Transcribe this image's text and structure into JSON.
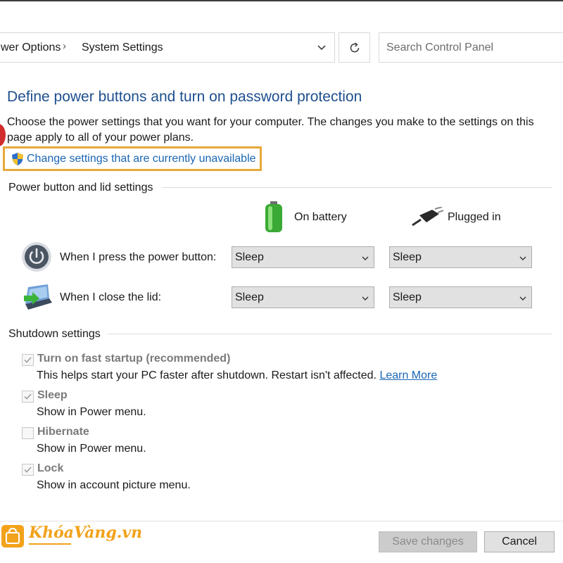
{
  "breadcrumb": {
    "item1": "wer Options",
    "separator": "›",
    "item2": "System Settings"
  },
  "search": {
    "placeholder": "Search Control Panel"
  },
  "page": {
    "title": "Define power buttons and turn on password protection",
    "description": "Choose the power settings that you want for your computer. The changes you make to the settings on this page apply to all of your power plans.",
    "change_link": "Change settings that are currently unavailable"
  },
  "power_section": {
    "label": "Power button and lid settings",
    "col_battery": "On battery",
    "col_plugged": "Plugged in",
    "rows": [
      {
        "label": "When I press the power button:",
        "battery": "Sleep",
        "plugged": "Sleep"
      },
      {
        "label": "When I close the lid:",
        "battery": "Sleep",
        "plugged": "Sleep"
      }
    ]
  },
  "shutdown_section": {
    "label": "Shutdown settings",
    "options": [
      {
        "title": "Turn on fast startup (recommended)",
        "desc": "This helps start your PC faster after shutdown. Restart isn't affected.",
        "link": "Learn More",
        "checked": true
      },
      {
        "title": "Sleep",
        "desc": "Show in Power menu.",
        "checked": true
      },
      {
        "title": "Hibernate",
        "desc": "Show in Power menu.",
        "checked": false
      },
      {
        "title": "Lock",
        "desc": "Show in account picture menu.",
        "checked": true
      }
    ]
  },
  "buttons": {
    "save": "Save changes",
    "cancel": "Cancel"
  },
  "watermark": {
    "text": "KhóaVàng.vn"
  },
  "colors": {
    "title_blue": "#1e4f8f",
    "link_blue": "#1a66b4",
    "highlight_orange": "#e6a93a",
    "brand_orange": "#f2a21a"
  }
}
